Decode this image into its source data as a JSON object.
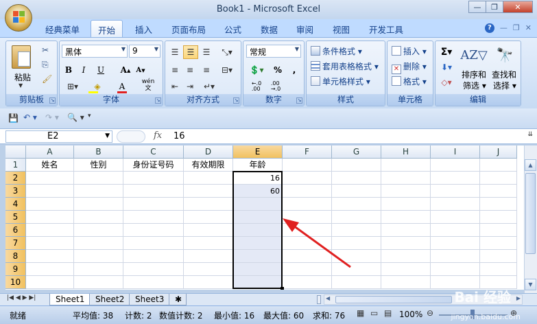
{
  "window": {
    "title": "Book1 - Microsoft Excel"
  },
  "tabs": [
    "经典菜单",
    "开始",
    "插入",
    "页面布局",
    "公式",
    "数据",
    "审阅",
    "视图",
    "开发工具"
  ],
  "active_tab": "开始",
  "ribbon": {
    "clipboard": {
      "paste": "粘贴",
      "label": "剪贴板"
    },
    "font": {
      "name": "黑体",
      "size": "9",
      "label": "字体",
      "bold": "B",
      "italic": "I",
      "underline": "U",
      "wen": "wén"
    },
    "alignment": {
      "label": "对齐方式"
    },
    "number": {
      "format": "常规",
      "percent": "%",
      "comma": ",",
      "label": "数字"
    },
    "styles": {
      "conditional": "条件格式",
      "table": "套用表格格式",
      "cell": "单元格样式",
      "label": "样式"
    },
    "cells": {
      "insert": "插入",
      "delete": "删除",
      "format": "格式",
      "label": "单元格"
    },
    "editing": {
      "sort": "排序和",
      "sort2": "筛选",
      "find": "查找和",
      "find2": "选择",
      "label": "编辑"
    }
  },
  "formula_bar": {
    "name_box": "E2",
    "fx": "fx",
    "value": "16"
  },
  "columns": [
    "A",
    "B",
    "C",
    "D",
    "E",
    "F",
    "G",
    "H",
    "I",
    "J"
  ],
  "rows": [
    "1",
    "2",
    "3",
    "4",
    "5",
    "6",
    "7",
    "8",
    "9",
    "10"
  ],
  "cells": {
    "A1": "姓名",
    "B1": "性别",
    "C1": "身份证号码",
    "D1": "有效期限",
    "E1": "年龄",
    "E2": "16",
    "E3": "60"
  },
  "sheets": [
    "Sheet1",
    "Sheet2",
    "Sheet3"
  ],
  "status": {
    "ready": "就绪",
    "average": "平均值: 38",
    "count": "计数: 2",
    "numcount": "数值计数: 2",
    "min": "最小值: 16",
    "max": "最大值: 60",
    "sum": "求和: 76",
    "zoom": "100%"
  },
  "watermark": {
    "text": "Bai 经验",
    "url": "jingyan.baidu.com"
  },
  "colors": {
    "accent": "#15428b",
    "selection": "#e4e9f6",
    "arrow": "#e02020"
  }
}
